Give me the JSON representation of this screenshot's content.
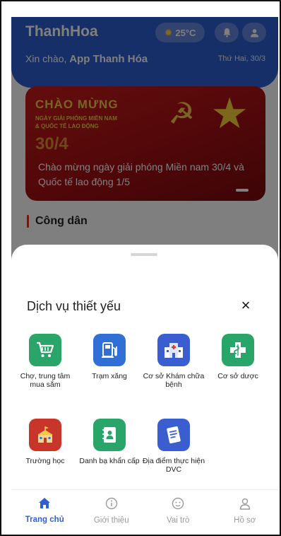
{
  "header": {
    "app_title": "ThanhHoa",
    "temperature": "25°C",
    "greeting_prefix": "Xin chào, ",
    "greeting_name": "App Thanh Hóa",
    "date": "Thứ Hai, 30/3"
  },
  "banner": {
    "heading": "CHÀO MỪNG",
    "sub": "NGÀY GIẢI PHÓNG MIỀN NAM & QUỐC TẾ LAO ĐỘNG",
    "date_mark": "30/4",
    "caption": "Chào mừng ngày giải phóng Miền nam 30/4 và Quốc tế lao động 1/5"
  },
  "section": {
    "title": "Công dân"
  },
  "sheet": {
    "title": "Dịch vụ thiết yếu",
    "close": "×",
    "services": [
      {
        "label": "Chợ, trung tâm mua sắm",
        "icon": "shopping-cart-icon",
        "color": "#2aa56a"
      },
      {
        "label": "Trạm xăng",
        "icon": "fuel-station-icon",
        "color": "#2f6fd6"
      },
      {
        "label": "Cơ sở Khám chữa bệnh",
        "icon": "hospital-icon",
        "color": "#3a5ed0"
      },
      {
        "label": "Cơ sở dược",
        "icon": "pharmacy-icon",
        "color": "#2aa56a"
      },
      {
        "label": "Trường học",
        "icon": "school-icon",
        "color": "#c8352b"
      },
      {
        "label": "Danh bạ khẩn cấp",
        "icon": "contacts-book-icon",
        "color": "#2aa56a"
      },
      {
        "label": "Địa điểm thực hiện DVC",
        "icon": "document-list-icon",
        "color": "#3a5ed0"
      }
    ]
  },
  "nav": {
    "items": [
      {
        "label": "Trang chủ",
        "icon": "home-icon",
        "active": true
      },
      {
        "label": "Giới thiệu",
        "icon": "info-icon",
        "active": false
      },
      {
        "label": "Vai trò",
        "icon": "role-face-icon",
        "active": false
      },
      {
        "label": "Hồ sơ",
        "icon": "profile-icon",
        "active": false
      }
    ]
  },
  "colors": {
    "primary": "#2f5fd0",
    "accent_red": "#d43b2b"
  }
}
